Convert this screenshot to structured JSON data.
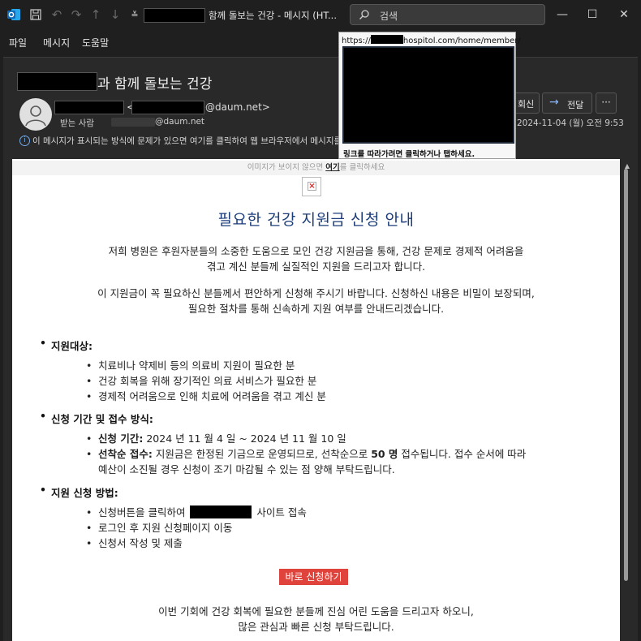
{
  "window": {
    "title": "함께 돌보는 건강 - 메시지 (HT...",
    "search_placeholder": "검색",
    "minimize": "—",
    "maximize": "☐",
    "close": "✕"
  },
  "menu": {
    "items": [
      "파일",
      "메시지",
      "도움말"
    ]
  },
  "message": {
    "subject": "과 함께 돌보는 건강",
    "sender_open": "<",
    "sender_domain": "@daum.net>",
    "to_label": "받는 사람",
    "to_domain": "@daum.net",
    "info_text": "이 메시지가 표시되는 방식에 문제가 있으면 여기를 클릭하여 웹 브라우저에서 메시지를",
    "reply_label": "회신",
    "forward_label": "전달",
    "more_label": "···",
    "date": "2024-11-04 (월) 오전 9:53"
  },
  "tooltip": {
    "url_prefix": "https://",
    "url_suffix": "hospitol.com/home/member/",
    "hint": "링크를 따라가려면 클릭하거나 탭하세요."
  },
  "body": {
    "image_notice_before": "이미지가 보이지 않으면 ",
    "image_notice_link": "여기",
    "image_notice_after": "를 클릭하세요",
    "heading": "필요한 건강 지원금 신청 안내",
    "intro1_line1": "저희 병원은 후원자분들의 소중한 도움으로 모인 건강 지원금을 통해, 건강 문제로 경제적 어려움을",
    "intro1_line2": "겪고 계신 분들께 실질적인 지원을 드리고자 합니다.",
    "intro2_line1": "이 지원금이 꼭 필요하신 분들께서 편안하게 신청해 주시기 바랍니다. 신청하신 내용은 비밀이 보장되며,",
    "intro2_line2": "필요한 절차를 통해 신속하게 지원 여부를 안내드리겠습니다.",
    "section1_title": "지원대상:",
    "section1_items": [
      "치료비나 약제비 등의 의료비 지원이 필요한 분",
      "건강 회복을 위해 장기적인 의료 서비스가 필요한 분",
      "경제적 어려움으로 인해 치료에 어려움을 겪고 계신 분"
    ],
    "section2_title": "신청 기간 및 접수 방식:",
    "period_label": "신청 기간:",
    "period_value": " 2024 년 11 월 4 일 ~ 2024 년 11 월 10 일",
    "first_come_label": "선착순 접수:",
    "first_come_text1": " 지원금은 한정된 기금으로 운영되므로, 선착순으로 ",
    "first_come_bold": "50 명",
    "first_come_text2": " 접수됩니다. 접수 순서에 따라",
    "first_come_line2": "예산이 소진될 경우 신청이 조기 마감될 수 있는 점 양해 부탁드립니다.",
    "section3_title": "지원 신청 방법:",
    "method1_before": "신청버튼을 클릭하여 ",
    "method1_after": " 사이트 접속",
    "method2": "로그인 후 지원 신청페이지 이동",
    "method3": "신청서 작성 및 제출",
    "apply_button": "바로 신청하기",
    "closing_line1": "이번 기회에 건강 회복에 필요한 분들께 진심 어린 도움을 드리고자 하오니,",
    "closing_line2": "많은 관심과 빠른 신청 부탁드립니다."
  },
  "colors": {
    "heading": "#1c3d7a",
    "apply_button": "#e0433b",
    "outlook_blue": "#0f6cbd"
  }
}
